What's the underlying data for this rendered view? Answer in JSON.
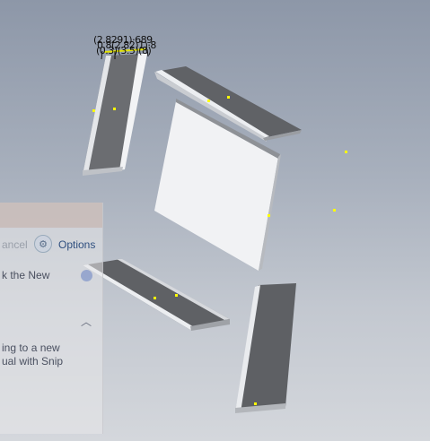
{
  "viewport": {
    "dimension_labels": [
      "(2.8291)·689",
      "0.8(2.82)1)·8",
      "(0.3)(3.5)(8)"
    ]
  },
  "snip_panel": {
    "cancel_label": "ancel",
    "options_label": "Options",
    "new_text": "k the New",
    "line1": "ing to a new",
    "line2": "ual with Snip"
  },
  "colors": {
    "background_top": "#8d97a8",
    "background_bottom": "#d4d7dc",
    "marker": "#ffff00",
    "part_face_light": "#f0f1f3",
    "part_face_dark": "#5c5e62"
  }
}
